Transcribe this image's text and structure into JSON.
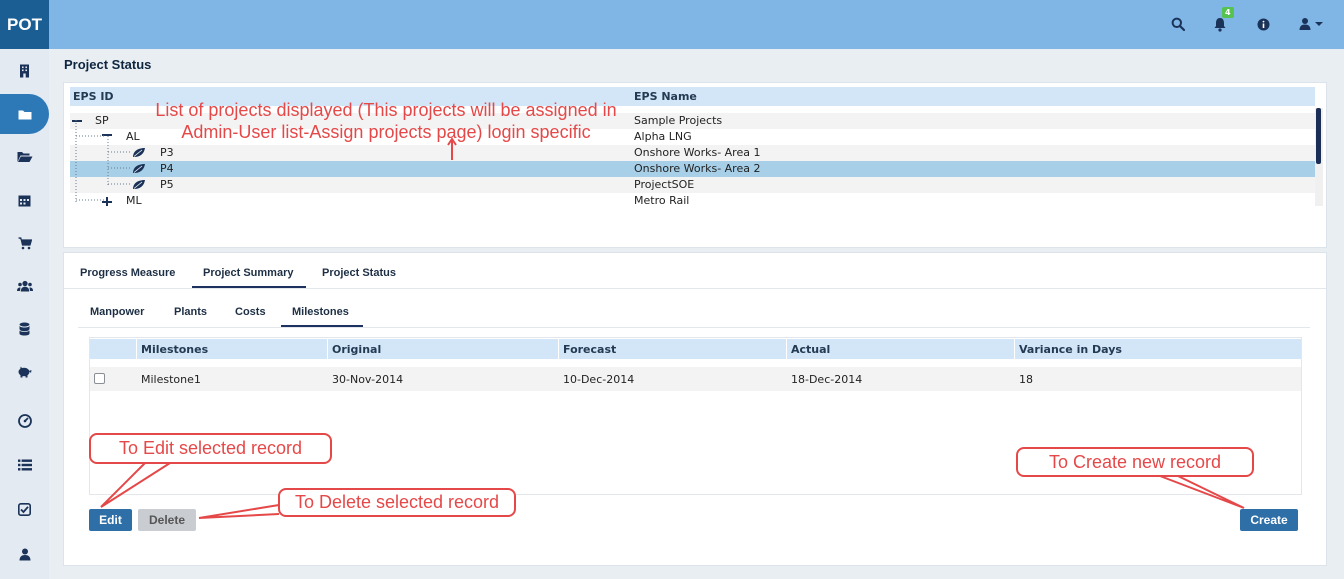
{
  "app": {
    "logo": "POT"
  },
  "header": {
    "icons": [
      "search-icon",
      "bell-icon",
      "info-icon",
      "user-icon",
      "caret-down-icon"
    ],
    "notification_count": "4",
    "brand_color": "#7fb6e6"
  },
  "sidebar": {
    "items": [
      {
        "icon": "building-icon"
      },
      {
        "icon": "folder-icon",
        "active": true
      },
      {
        "icon": "folder-open-icon"
      },
      {
        "icon": "calendar-icon"
      },
      {
        "icon": "cart-icon"
      },
      {
        "icon": "users-icon"
      },
      {
        "icon": "database-icon"
      },
      {
        "icon": "piggy-bank-icon"
      },
      {
        "icon": "dashboard-icon"
      },
      {
        "icon": "list-icon"
      },
      {
        "icon": "checklist-icon"
      },
      {
        "icon": "user-icon"
      }
    ]
  },
  "page": {
    "title": "Project Status"
  },
  "eps_table": {
    "headers": {
      "id": "EPS ID",
      "name": "EPS Name"
    },
    "rows": [
      {
        "id": "SP",
        "name": "Sample Projects",
        "level": 0,
        "toggle": "-"
      },
      {
        "id": "AL",
        "name": "Alpha LNG",
        "level": 1,
        "toggle": "-"
      },
      {
        "id": "P3",
        "name": "Onshore Works- Area 1",
        "level": 2,
        "leaf": true
      },
      {
        "id": "P4",
        "name": "Onshore Works- Area 2",
        "level": 2,
        "leaf": true,
        "selected": true
      },
      {
        "id": "P5",
        "name": "ProjectSOE",
        "level": 2,
        "leaf": true
      },
      {
        "id": "ML",
        "name": "Metro Rail",
        "level": 1,
        "toggle": "+"
      }
    ]
  },
  "main_tabs": [
    {
      "label": "Progress Measure"
    },
    {
      "label": "Project Summary",
      "active": true
    },
    {
      "label": "Project Status"
    }
  ],
  "sub_tabs": [
    {
      "label": "Manpower"
    },
    {
      "label": "Plants"
    },
    {
      "label": "Costs"
    },
    {
      "label": "Milestones",
      "active": true
    }
  ],
  "milestones_table": {
    "headers": [
      "Milestones",
      "Original",
      "Forecast",
      "Actual",
      "Variance in Days"
    ],
    "rows": [
      [
        "Milestone1",
        "30-Nov-2014",
        "10-Dec-2014",
        "18-Dec-2014",
        "18"
      ]
    ]
  },
  "buttons": {
    "edit": "Edit",
    "delete": "Delete",
    "create": "Create"
  },
  "annotations": {
    "projects_line1": "List of projects displayed (This projects will be assigned in",
    "projects_line2": "Admin-User list-Assign projects page) login specific",
    "edit": "To Edit selected record",
    "delete": "To Delete selected record",
    "create": "To Create new record",
    "color": "#e54848"
  }
}
